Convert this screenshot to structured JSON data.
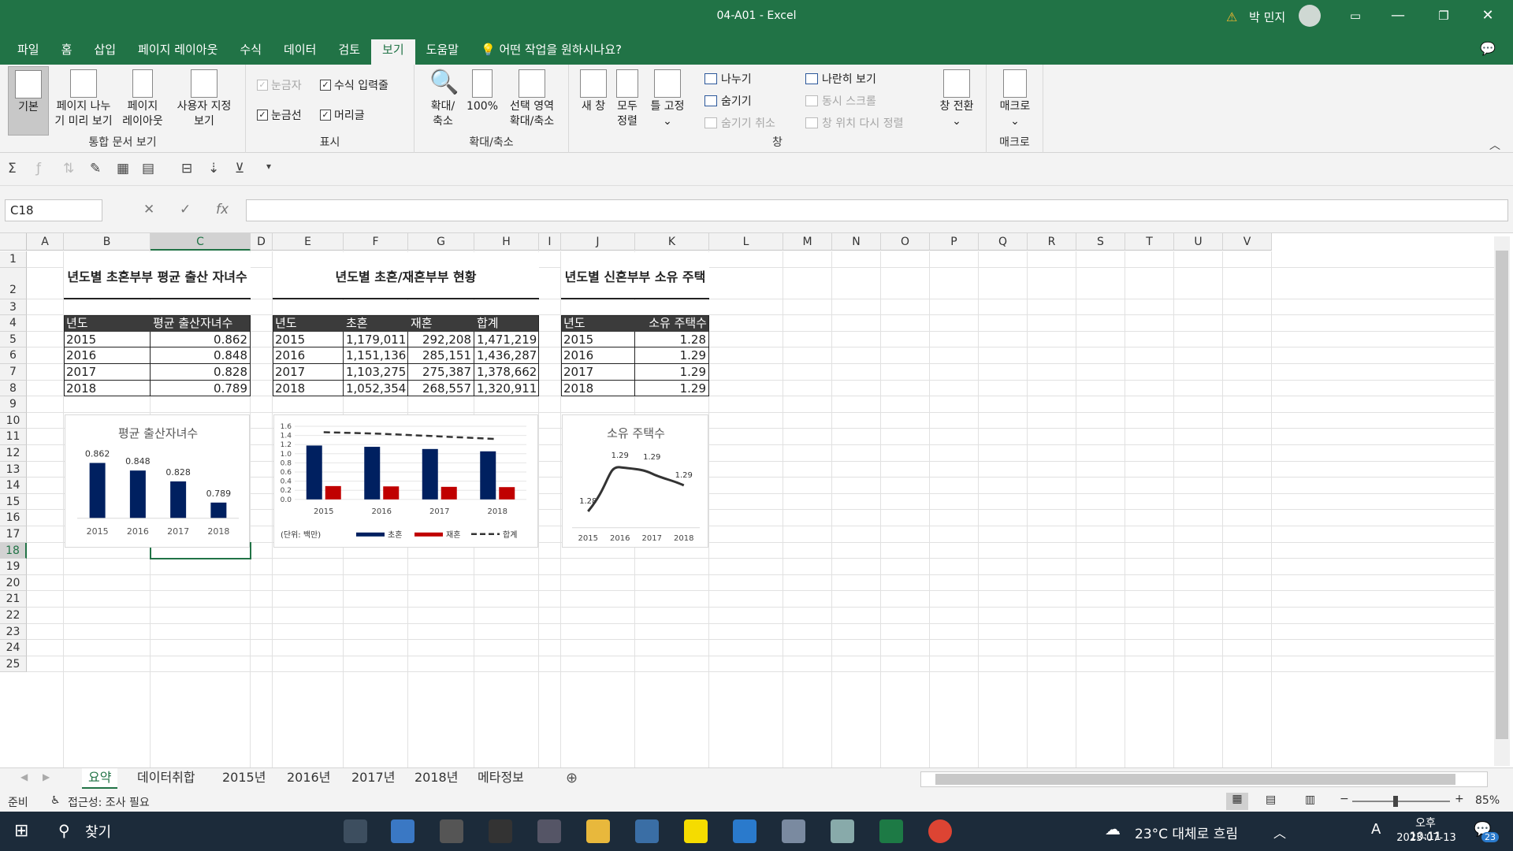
{
  "window": {
    "title": "04-A01  -  Excel",
    "user": "박 민지"
  },
  "menu": [
    "파일",
    "홈",
    "삽입",
    "페이지 레이아웃",
    "수식",
    "데이터",
    "검토",
    "보기",
    "도움말",
    "어떤 작업을 원하시나요?"
  ],
  "ribbon": {
    "workbook_views": {
      "label": "통합 문서 보기",
      "normal": "기본",
      "page_break_1": "페이지 나누",
      "page_break_2": "기 미리 보기",
      "page_layout_1": "페이지",
      "page_layout_2": "레이아웃",
      "custom_1": "사용자 지정",
      "custom_2": "보기"
    },
    "show": {
      "label": "표시",
      "ruler": "눈금자",
      "formula_bar": "수식 입력줄",
      "gridlines": "눈금선",
      "headings": "머리글"
    },
    "zoom": {
      "label": "확대/축소",
      "zoom_1": "확대/",
      "zoom_2": "축소",
      "pct": "100%",
      "sel_1": "선택 영역",
      "sel_2": "확대/축소"
    },
    "window": {
      "label": "창",
      "new_window": "새 창",
      "arrange_1": "모두",
      "arrange_2": "정렬",
      "freeze": "틀 고정",
      "split": "나누기",
      "hide": "숨기기",
      "unhide": "숨기기 취소",
      "side": "나란히 보기",
      "sync": "동시 스크롤",
      "reset": "창 위치 다시 정렬",
      "switch": "창 전환"
    },
    "macros": {
      "label": "매크로",
      "btn": "매크로"
    }
  },
  "formula_bar": {
    "name_box": "C18",
    "fx": "fx",
    "value": ""
  },
  "columns": [
    "A",
    "B",
    "C",
    "D",
    "E",
    "F",
    "G",
    "H",
    "I",
    "J",
    "K",
    "L",
    "M",
    "N",
    "O",
    "P",
    "Q",
    "R",
    "S",
    "T",
    "U",
    "V"
  ],
  "rows": [
    "1",
    "2",
    "3",
    "4",
    "5",
    "6",
    "7",
    "8",
    "9",
    "10",
    "11",
    "12",
    "13",
    "14",
    "15",
    "16",
    "17",
    "18",
    "19",
    "20",
    "21",
    "22",
    "23",
    "24",
    "25"
  ],
  "table1": {
    "title": "년도별 초혼부부 평균 출산 자녀수",
    "headers": [
      "년도",
      "평균 출산자녀수"
    ],
    "rows": [
      [
        "2015",
        "0.862"
      ],
      [
        "2016",
        "0.848"
      ],
      [
        "2017",
        "0.828"
      ],
      [
        "2018",
        "0.789"
      ]
    ]
  },
  "table2": {
    "title": "년도별 초혼/재혼부부 현황",
    "headers": [
      "년도",
      "초혼",
      "재혼",
      "합계"
    ],
    "rows": [
      [
        "2015",
        "1,179,011",
        "292,208",
        "1,471,219"
      ],
      [
        "2016",
        "1,151,136",
        "285,151",
        "1,436,287"
      ],
      [
        "2017",
        "1,103,275",
        "275,387",
        "1,378,662"
      ],
      [
        "2018",
        "1,052,354",
        "268,557",
        "1,320,911"
      ]
    ]
  },
  "table3": {
    "title": "년도별 신혼부부 소유 주택수",
    "headers": [
      "년도",
      "소유 주택수"
    ],
    "rows": [
      [
        "2015",
        "1.28"
      ],
      [
        "2016",
        "1.29"
      ],
      [
        "2017",
        "1.29"
      ],
      [
        "2018",
        "1.29"
      ]
    ]
  },
  "chart_data": [
    {
      "type": "bar",
      "title": "평균 출산자녀수",
      "categories": [
        "2015",
        "2016",
        "2017",
        "2018"
      ],
      "values": [
        0.862,
        0.848,
        0.828,
        0.789
      ],
      "data_labels": [
        "0.862",
        "0.848",
        "0.828",
        "0.789"
      ],
      "ylim": [
        0.76,
        0.87
      ]
    },
    {
      "type": "bar",
      "title": "",
      "categories": [
        "2015",
        "2016",
        "2017",
        "2018"
      ],
      "series": [
        {
          "name": "초혼",
          "type": "bar",
          "color": "#002060",
          "values": [
            1.179,
            1.151,
            1.103,
            1.052
          ]
        },
        {
          "name": "재혼",
          "type": "bar",
          "color": "#c00000",
          "values": [
            0.292,
            0.285,
            0.275,
            0.269
          ]
        },
        {
          "name": "합계",
          "type": "line",
          "style": "dashed",
          "color": "#333333",
          "values": [
            1.471,
            1.436,
            1.379,
            1.321
          ]
        }
      ],
      "ylim": [
        0,
        1.6
      ],
      "yticks": [
        "0.0",
        "0.2",
        "0.4",
        "0.6",
        "0.8",
        "1.0",
        "1.2",
        "1.4",
        "1.6"
      ],
      "note": "(단위: 백만)",
      "legend": "bottom"
    },
    {
      "type": "line",
      "title": "소유 주택수",
      "categories": [
        "2015",
        "2016",
        "2017",
        "2018"
      ],
      "values": [
        1.28,
        1.29,
        1.29,
        1.29
      ],
      "data_labels": [
        "1.28",
        "1.29",
        "1.29",
        "1.29"
      ],
      "smooth": true
    }
  ],
  "sheets": [
    "요약",
    "데이터취합",
    "2015년",
    "2016년",
    "2017년",
    "2018년",
    "메타정보"
  ],
  "status": {
    "ready": "준비",
    "accessibility": "접근성: 조사 필요",
    "zoom": "85%"
  },
  "taskbar": {
    "search": "찾기",
    "weather": "23°C  대체로 흐림",
    "time": "오후 10:11",
    "date": "2023-07-13",
    "badge": "23",
    "ime": "A"
  }
}
